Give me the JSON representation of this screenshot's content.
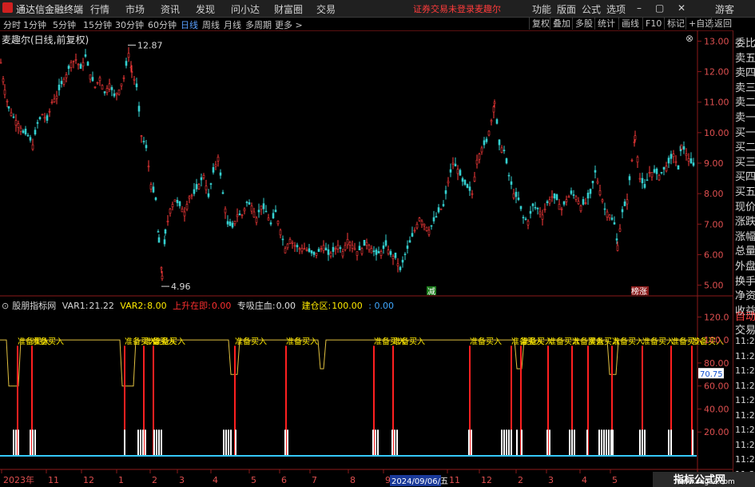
{
  "app": {
    "title": "通达信金融终端",
    "menu": [
      "行情",
      "市场",
      "资讯",
      "发现",
      "问小达",
      "财富圈",
      "交易"
    ],
    "warning": "证券交易未登录",
    "stock_short": "麦趣尔",
    "right_menu": [
      "功能",
      "版面",
      "公式",
      "选项"
    ],
    "guest": "游客"
  },
  "periods": {
    "items": [
      "分时",
      "1分钟",
      "5分钟",
      "15分钟",
      "30分钟",
      "60分钟",
      "日线",
      "周线",
      "月线",
      "多周期",
      "更多 >"
    ],
    "active": "日线",
    "tools": [
      "复权",
      "叠加",
      "多股",
      "统计",
      "画线",
      "F10",
      "标记",
      "+自选",
      "返回"
    ]
  },
  "chart": {
    "title": "麦趣尔(日线,前复权)",
    "close_icon": "close-icon",
    "high_label": "12.87",
    "low_label": "4.96",
    "price_ticks": [
      "13.00",
      "12.00",
      "11.00",
      "10.00",
      "9.00",
      "8.00",
      "7.00",
      "6.00",
      "5.00"
    ],
    "badge_left": "减",
    "badge_right": "榜涨"
  },
  "indicator": {
    "name": "股朋指标网",
    "var1_label": "VAR1:",
    "var1": "21.22",
    "var2_label": "VAR2:",
    "var2": "8.00",
    "rise_label": "上升在即:",
    "rise": "0.00",
    "absorb_label": "专吸庄血:",
    "absorb": "0.00",
    "build_label": "建仓区:",
    "build": "100.00",
    "extra": ": 0.00",
    "ticks": [
      "120.0",
      "100.0",
      "80.00",
      "60.00",
      "40.00",
      "20.00"
    ],
    "current_value": "70.75",
    "signal_text": "准备买入"
  },
  "xaxis": {
    "labels": [
      "2023年",
      "11",
      "12",
      "1",
      "2",
      "3",
      "4",
      "5",
      "6",
      "7",
      "8",
      "9",
      "11",
      "12",
      "2",
      "3",
      "4",
      "5"
    ],
    "cursor_date": "2024/09/06/五"
  },
  "right_panel": {
    "items": [
      "委比",
      "卖五",
      "卖四",
      "卖三",
      "卖二",
      "卖一",
      "买一",
      "买二",
      "买三",
      "买四",
      "买五",
      "现价",
      "涨跌",
      "涨幅",
      "总量",
      "外盘",
      "换手",
      "净资",
      "收益"
    ],
    "auto": "自动",
    "trade": "交易",
    "times": [
      "11:29",
      "11:29",
      "11:29",
      "11:29",
      "11:29",
      "11:29",
      "11:29",
      "11:29",
      "11:29",
      "11:29"
    ]
  },
  "watermark": {
    "cn": "指标公式网",
    "url": "www.zbgs3.com"
  },
  "chart_data": {
    "type": "candlestick",
    "ylim": [
      4.7,
      13.3
    ],
    "price_series": [
      [
        0,
        12.3
      ],
      [
        5,
        11.4
      ],
      [
        10,
        10.8
      ],
      [
        16,
        10.5
      ],
      [
        22,
        10.3
      ],
      [
        28,
        10.0
      ],
      [
        34,
        9.9
      ],
      [
        40,
        9.6
      ],
      [
        46,
        10.3
      ],
      [
        52,
        10.6
      ],
      [
        58,
        10.4
      ],
      [
        64,
        11.0
      ],
      [
        70,
        11.2
      ],
      [
        76,
        11.6
      ],
      [
        82,
        11.9
      ],
      [
        88,
        12.3
      ],
      [
        94,
        12.4
      ],
      [
        100,
        12.1
      ],
      [
        106,
        12.5
      ],
      [
        112,
        11.9
      ],
      [
        118,
        11.5
      ],
      [
        124,
        11.8
      ],
      [
        130,
        11.3
      ],
      [
        136,
        11.6
      ],
      [
        142,
        11.2
      ],
      [
        148,
        11.4
      ],
      [
        154,
        11.8
      ],
      [
        160,
        12.6
      ],
      [
        164,
        12.0
      ],
      [
        170,
        11.5
      ],
      [
        176,
        9.9
      ],
      [
        182,
        9.5
      ],
      [
        188,
        8.3
      ],
      [
        194,
        7.8
      ],
      [
        198,
        6.4
      ],
      [
        202,
        5.3
      ],
      [
        206,
        6.7
      ],
      [
        212,
        7.5
      ],
      [
        218,
        7.8
      ],
      [
        224,
        7.6
      ],
      [
        230,
        7.4
      ],
      [
        236,
        7.9
      ],
      [
        242,
        8.0
      ],
      [
        248,
        8.3
      ],
      [
        254,
        8.6
      ],
      [
        260,
        7.9
      ],
      [
        266,
        8.7
      ],
      [
        272,
        9.2
      ],
      [
        278,
        8.0
      ],
      [
        284,
        7.0
      ],
      [
        290,
        6.9
      ],
      [
        296,
        7.3
      ],
      [
        302,
        7.3
      ],
      [
        308,
        7.7
      ],
      [
        314,
        7.6
      ],
      [
        320,
        7.2
      ],
      [
        326,
        7.6
      ],
      [
        332,
        7.4
      ],
      [
        338,
        7.0
      ],
      [
        344,
        7.4
      ],
      [
        350,
        6.8
      ],
      [
        356,
        6.2
      ],
      [
        362,
        6.5
      ],
      [
        368,
        6.3
      ],
      [
        374,
        6.2
      ],
      [
        380,
        6.2
      ],
      [
        386,
        6.1
      ],
      [
        392,
        6.0
      ],
      [
        398,
        6.1
      ],
      [
        404,
        6.3
      ],
      [
        410,
        6.0
      ],
      [
        416,
        6.1
      ],
      [
        422,
        6.3
      ],
      [
        428,
        6.1
      ],
      [
        434,
        6.5
      ],
      [
        440,
        6.3
      ],
      [
        446,
        6.1
      ],
      [
        452,
        6.2
      ],
      [
        458,
        6.4
      ],
      [
        464,
        6.2
      ],
      [
        470,
        6.0
      ],
      [
        476,
        6.1
      ],
      [
        482,
        6.3
      ],
      [
        488,
        6.0
      ],
      [
        494,
        5.9
      ],
      [
        500,
        5.5
      ],
      [
        506,
        6.0
      ],
      [
        512,
        6.4
      ],
      [
        518,
        6.8
      ],
      [
        524,
        7.2
      ],
      [
        530,
        7.0
      ],
      [
        536,
        6.8
      ],
      [
        542,
        7.1
      ],
      [
        548,
        7.4
      ],
      [
        554,
        7.6
      ],
      [
        560,
        8.4
      ],
      [
        566,
        9.0
      ],
      [
        572,
        8.8
      ],
      [
        578,
        8.4
      ],
      [
        584,
        8.2
      ],
      [
        590,
        8.0
      ],
      [
        596,
        9.1
      ],
      [
        602,
        9.5
      ],
      [
        608,
        9.7
      ],
      [
        614,
        10.4
      ],
      [
        618,
        11.0
      ],
      [
        624,
        9.6
      ],
      [
        630,
        9.4
      ],
      [
        636,
        8.6
      ],
      [
        642,
        8.0
      ],
      [
        648,
        7.8
      ],
      [
        654,
        7.2
      ],
      [
        660,
        7.1
      ],
      [
        666,
        7.6
      ],
      [
        672,
        7.5
      ],
      [
        678,
        7.3
      ],
      [
        684,
        7.7
      ],
      [
        690,
        7.9
      ],
      [
        696,
        7.8
      ],
      [
        702,
        7.5
      ],
      [
        708,
        7.8
      ],
      [
        714,
        8.0
      ],
      [
        720,
        7.9
      ],
      [
        726,
        7.6
      ],
      [
        732,
        7.7
      ],
      [
        738,
        8.0
      ],
      [
        744,
        8.7
      ],
      [
        750,
        8.1
      ],
      [
        756,
        7.5
      ],
      [
        762,
        7.3
      ],
      [
        768,
        7.0
      ],
      [
        772,
        6.3
      ],
      [
        778,
        7.4
      ],
      [
        784,
        7.8
      ],
      [
        790,
        9.1
      ],
      [
        794,
        9.9
      ],
      [
        800,
        8.5
      ],
      [
        806,
        8.2
      ],
      [
        812,
        8.7
      ],
      [
        818,
        8.7
      ],
      [
        824,
        8.6
      ],
      [
        830,
        8.8
      ],
      [
        836,
        9.0
      ],
      [
        842,
        9.3
      ],
      [
        848,
        8.8
      ],
      [
        852,
        9.6
      ],
      [
        858,
        9.3
      ],
      [
        864,
        9.0
      ],
      [
        868,
        8.9
      ]
    ],
    "indicator_bars_x": [
      16,
      19,
      22,
      37,
      40,
      43,
      155,
      172,
      175,
      178,
      181,
      192,
      195,
      198,
      201,
      279,
      282,
      285,
      288,
      294,
      356,
      359,
      466,
      469,
      472,
      490,
      493,
      496,
      586,
      589,
      627,
      630,
      633,
      636,
      639,
      646,
      652,
      684,
      687,
      712,
      715,
      718,
      734,
      749,
      752,
      755,
      758,
      761,
      764,
      766,
      800,
      803,
      806,
      836,
      839,
      866
    ]
  }
}
